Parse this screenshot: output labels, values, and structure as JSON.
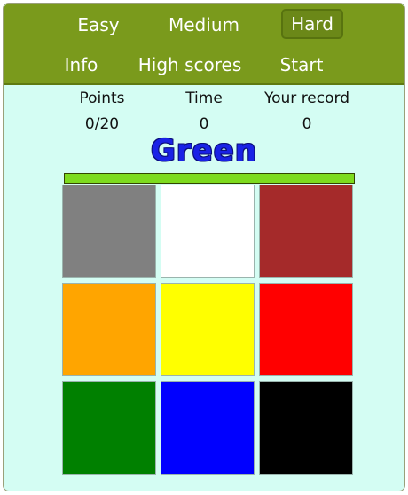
{
  "menu": {
    "items": [
      {
        "id": "easy",
        "label": "Easy",
        "active": false
      },
      {
        "id": "medium",
        "label": "Medium",
        "active": false
      },
      {
        "id": "hard",
        "label": "Hard",
        "active": true
      },
      {
        "id": "info",
        "label": "Info",
        "active": false
      },
      {
        "id": "high-scores",
        "label": "High scores",
        "active": false
      },
      {
        "id": "start",
        "label": "Start",
        "active": false
      }
    ]
  },
  "stats": {
    "points_label": "Points",
    "points_value": "0/20",
    "time_label": "Time",
    "time_value": "0",
    "record_label": "Your record",
    "record_value": "0"
  },
  "target": {
    "word": "Green",
    "text_color": "#1a22e6"
  },
  "timer": {
    "fill_fraction": 1.0,
    "fill_color": "#7ddb1e"
  },
  "tiles": [
    {
      "name": "gray",
      "color": "#808080"
    },
    {
      "name": "white",
      "color": "#ffffff"
    },
    {
      "name": "brown",
      "color": "#a52a2a"
    },
    {
      "name": "orange",
      "color": "#ffa500"
    },
    {
      "name": "yellow",
      "color": "#ffff00"
    },
    {
      "name": "red",
      "color": "#ff0000"
    },
    {
      "name": "green",
      "color": "#008000"
    },
    {
      "name": "blue",
      "color": "#0000ff"
    },
    {
      "name": "black",
      "color": "#000000"
    }
  ],
  "colors": {
    "menu_bg": "#7a9a1c",
    "page_bg": "#d4fdf3"
  }
}
